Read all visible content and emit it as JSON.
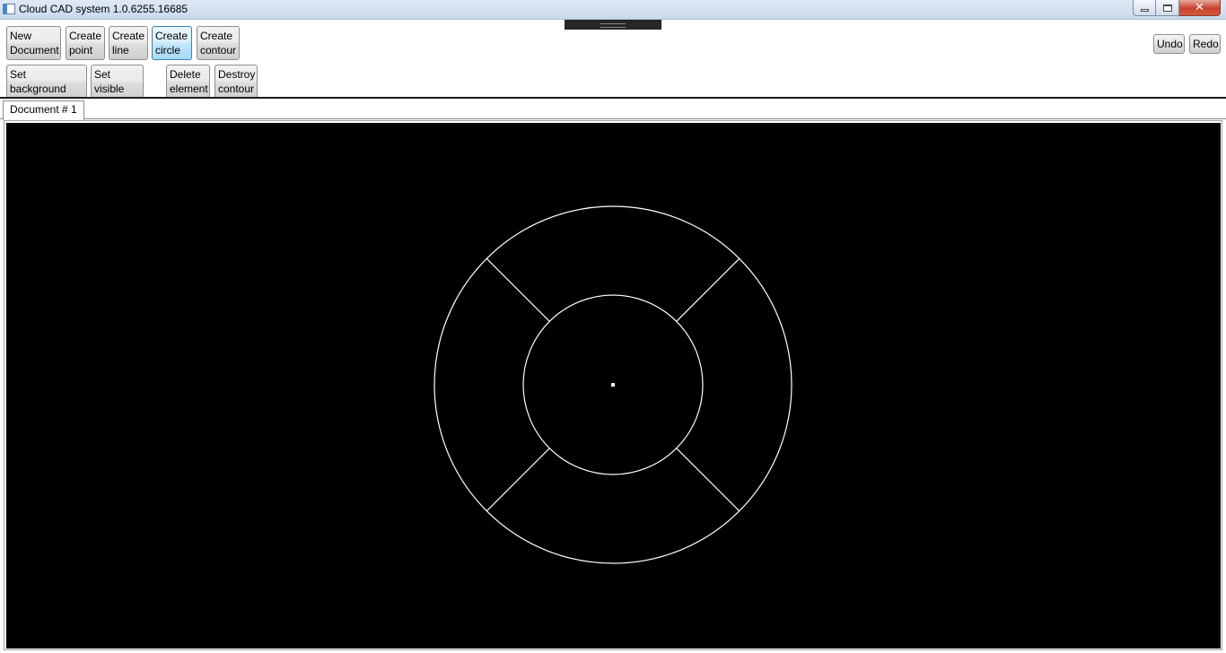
{
  "window": {
    "title": "Cloud CAD system 1.0.6255.16685",
    "controls": {
      "minimize": "minimize-icon",
      "maximize": "restore-icon",
      "close": "close-icon"
    }
  },
  "toolbar": {
    "new_document": "New\nDocument",
    "create_point": "Create\npoint",
    "create_line": "Create\nline",
    "create_circle": "Create\ncircle",
    "create_contour": "Create\ncontour",
    "set_background_color": "Set background\ncolor",
    "set_visible_layer": "Set visible\nlayer",
    "delete_element": "Delete\nelement",
    "destroy_contour": "Destroy\ncontour",
    "undo": "Undo",
    "redo": "Redo",
    "active_tool": "Create circle"
  },
  "tabs": [
    {
      "label": "Document # 1",
      "selected": true
    }
  ],
  "canvas": {
    "background_color": "#000000",
    "stroke_color": "#ffffff",
    "drawing": {
      "center": [
        0,
        0
      ],
      "outer_circle_radius": 199,
      "inner_circle_radius": 100,
      "radial_lines_angles_deg": [
        45,
        135,
        225,
        315
      ],
      "center_point": true
    }
  }
}
